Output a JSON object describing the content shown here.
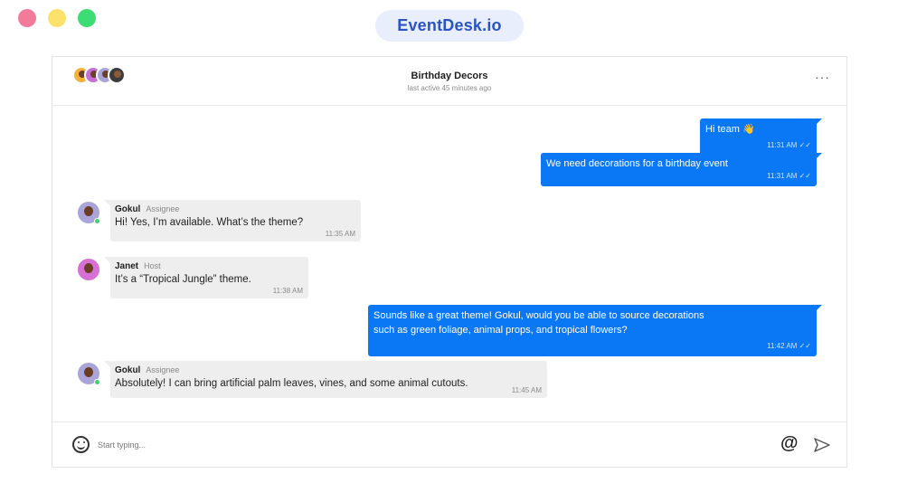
{
  "brand": {
    "name": "EventDesk.io"
  },
  "header": {
    "title": "Birthday Decors",
    "status": "last active 45 minutes ago",
    "more_label": "···"
  },
  "messages": [
    {
      "direction": "out",
      "text": "Hi team 👋",
      "time": "11:31 AM",
      "read_icon": "double-check-icon"
    },
    {
      "direction": "out",
      "text": "We need decorations for a birthday event",
      "time": "11:31 AM",
      "read_icon": "double-check-icon"
    },
    {
      "direction": "in",
      "sender": "Gokul",
      "role": "Assignee",
      "text": "Hi! Yes, I’m available. What’s the theme?",
      "time": "11:35 AM",
      "online": true
    },
    {
      "direction": "in",
      "sender": "Janet",
      "role": "Host",
      "text": "It’s a “Tropical Jungle” theme.",
      "time": "11:38 AM",
      "online": false
    },
    {
      "direction": "out",
      "text": "Sounds like a great theme! Gokul, would you be able to source decorations",
      "text2": "such as green foliage, animal props, and tropical flowers?",
      "time": "11:42 AM",
      "read_icon": "double-check-icon"
    },
    {
      "direction": "in",
      "sender": "Gokul",
      "role": "Assignee",
      "text": "Absolutely! I can bring artificial palm leaves, vines, and some animal cutouts.",
      "time": "11:45 AM",
      "online": true
    }
  ],
  "composer": {
    "placeholder": "Start typing...",
    "value": "",
    "emoji_icon": "smiley-icon",
    "mention_icon": "at-icon",
    "send_icon": "send-icon"
  },
  "colors": {
    "accent": "#0a78f5",
    "brand_text": "#2a54c6",
    "brand_bg": "#e8eefb",
    "incoming_bg": "#eeeeee",
    "online": "#3dd46f"
  }
}
